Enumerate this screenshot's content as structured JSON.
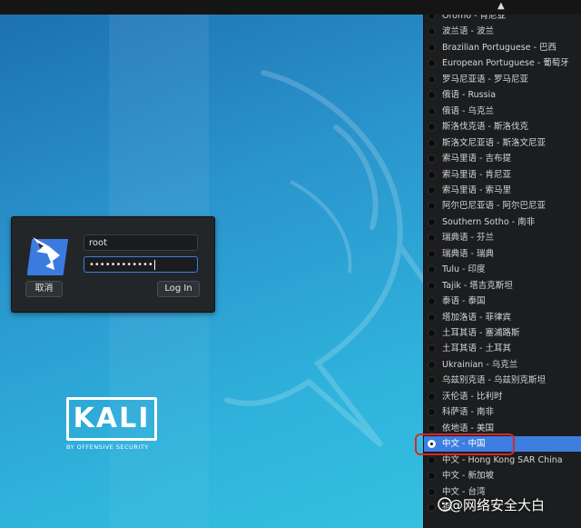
{
  "login": {
    "username": "root",
    "password_mask": "••••••••••••",
    "cancel_label": "取消",
    "login_label": "Log In"
  },
  "branding": {
    "logo_text": "KALI",
    "tagline": "BY OFFENSIVE SECURITY"
  },
  "language_menu": {
    "items": [
      {
        "label": "Oromo - 肯尼亚",
        "selected": false
      },
      {
        "label": "波兰语 - 波兰",
        "selected": false
      },
      {
        "label": "Brazilian Portuguese - 巴西",
        "selected": false
      },
      {
        "label": "European Portuguese - 葡萄牙",
        "selected": false
      },
      {
        "label": "罗马尼亚语 - 罗马尼亚",
        "selected": false
      },
      {
        "label": "俄语 - Russia",
        "selected": false
      },
      {
        "label": "俄语 - 乌克兰",
        "selected": false
      },
      {
        "label": "斯洛伐克语 - 斯洛伐克",
        "selected": false
      },
      {
        "label": "斯洛文尼亚语 - 斯洛文尼亚",
        "selected": false
      },
      {
        "label": "索马里语 - 吉布提",
        "selected": false
      },
      {
        "label": "索马里语 - 肯尼亚",
        "selected": false
      },
      {
        "label": "索马里语 - 索马里",
        "selected": false
      },
      {
        "label": "阿尔巴尼亚语 - 阿尔巴尼亚",
        "selected": false
      },
      {
        "label": "Southern Sotho - 南非",
        "selected": false
      },
      {
        "label": "瑞典语 - 芬兰",
        "selected": false
      },
      {
        "label": "瑞典语 - 瑞典",
        "selected": false
      },
      {
        "label": "Tulu - 印度",
        "selected": false
      },
      {
        "label": "Tajik - 塔吉克斯坦",
        "selected": false
      },
      {
        "label": "泰语 - 泰国",
        "selected": false
      },
      {
        "label": "塔加洛语 - 菲律宾",
        "selected": false
      },
      {
        "label": "土耳其语 - 塞浦路斯",
        "selected": false
      },
      {
        "label": "土耳其语 - 土耳其",
        "selected": false
      },
      {
        "label": "Ukrainian - 乌克兰",
        "selected": false
      },
      {
        "label": "乌兹别克语 - 乌兹别克斯坦",
        "selected": false
      },
      {
        "label": "沃伦语 - 比利时",
        "selected": false
      },
      {
        "label": "科萨语 - 南非",
        "selected": false
      },
      {
        "label": "依地语 - 美国",
        "selected": false
      },
      {
        "label": "中文 - 中国",
        "selected": true
      },
      {
        "label": "中文 - Hong Kong SAR China",
        "selected": false
      },
      {
        "label": "中文 - 新加坡",
        "selected": false
      },
      {
        "label": "中文 - 台湾",
        "selected": false
      },
      {
        "label": "祖",
        "selected": false
      }
    ]
  },
  "watermark": {
    "text": "@网络安全大白"
  },
  "colors": {
    "selection": "#3d7ee0",
    "annotation": "#d22a2a"
  }
}
